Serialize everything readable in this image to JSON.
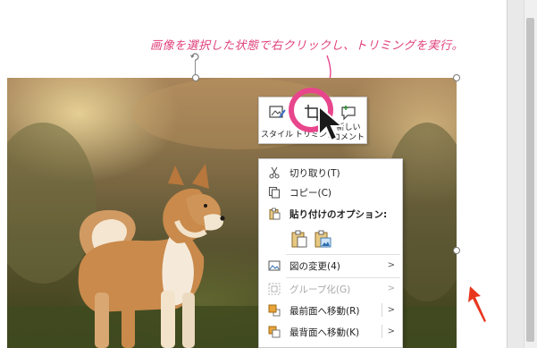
{
  "annotation": {
    "text": "画像を選択した状態で右クリックし、トリミングを実行。",
    "color": "#e0407b"
  },
  "mini_toolbar": {
    "buttons": [
      {
        "label": "スタイル",
        "icon": "style-icon"
      },
      {
        "label": "トリミング",
        "icon": "crop-icon"
      },
      {
        "label_line1": "新しい",
        "label_line2": "コメント",
        "icon": "new-comment-icon"
      }
    ]
  },
  "context_menu": {
    "items": [
      {
        "label": "切り取り(T)",
        "icon": "scissors-icon"
      },
      {
        "label": "コピー(C)",
        "icon": "copy-icon"
      },
      {
        "label": "貼り付けのオプション:",
        "icon": "paste-icon"
      },
      {
        "label": "図の変更(4)",
        "icon": "change-picture-icon",
        "submenu": ">"
      },
      {
        "label": "グループ化(G)",
        "icon": "group-icon",
        "submenu": ">",
        "disabled": true
      },
      {
        "label": "最前面へ移動(R)",
        "icon": "bring-to-front-icon",
        "submenu": ">"
      },
      {
        "label": "最背面へ移動(K)",
        "icon": "send-to-back-icon",
        "submenu": ">"
      }
    ],
    "paste_options": [
      "paste-keep-source-icon",
      "paste-as-picture-icon"
    ]
  },
  "colors": {
    "highlight": "#e8468c",
    "arrow": "#e8361e"
  }
}
